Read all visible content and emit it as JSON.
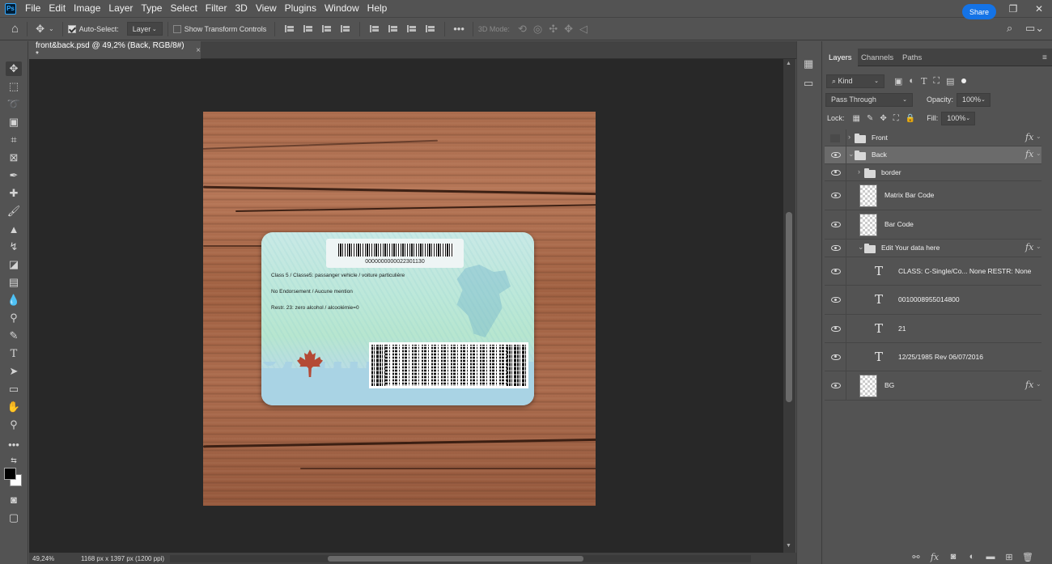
{
  "app": {
    "logo": "Ps"
  },
  "menu": [
    "File",
    "Edit",
    "Image",
    "Layer",
    "Type",
    "Select",
    "Filter",
    "3D",
    "View",
    "Plugins",
    "Window",
    "Help"
  ],
  "window_controls": {
    "minimize": "—",
    "restore": "❐",
    "close": "✕"
  },
  "options": {
    "auto_select_label": "Auto-Select:",
    "auto_select_checked": true,
    "auto_select_target": "Layer",
    "show_transform_label": "Show Transform Controls",
    "show_transform_checked": false,
    "mode_3d_label": "3D Mode:",
    "more": "•••",
    "share_label": "Share"
  },
  "document": {
    "tab_title": "front&back.psd @ 49,2% (Back, RGB/8#) *",
    "close": "×",
    "zoom": "49,24%",
    "doc_info": "1168 px x 1397 px (1200 ppi)"
  },
  "card": {
    "barcode_number": "0000000000022301130",
    "line1": "Class 5 / Classe5: passanger vehicle / voiture particulière",
    "line2": "No Endorsement / Aucune mention",
    "line3": "Restr. 23: zero alcohol / alcoolémie=0"
  },
  "panel": {
    "tabs": [
      "Layers",
      "Channels",
      "Paths"
    ],
    "active_tab": 0,
    "filter_label": "Kind",
    "blend_mode": "Pass Through",
    "opacity_label": "Opacity:",
    "opacity": "100%",
    "lock_label": "Lock:",
    "fill_label": "Fill:",
    "fill": "100%"
  },
  "layers": [
    {
      "name": "Front",
      "type": "group",
      "visible": false,
      "fx": true,
      "expanded": false,
      "indent": 0
    },
    {
      "name": "Back",
      "type": "group",
      "visible": true,
      "fx": true,
      "expanded": true,
      "indent": 0,
      "selected": true
    },
    {
      "name": "border",
      "type": "group",
      "visible": true,
      "fx": false,
      "expanded": false,
      "indent": 1
    },
    {
      "name": "Matrix Bar Code",
      "type": "pixel",
      "visible": true,
      "fx": false,
      "indent": 1
    },
    {
      "name": "Bar Code",
      "type": "pixel",
      "visible": true,
      "fx": false,
      "indent": 1
    },
    {
      "name": "Edit Your data here",
      "type": "group",
      "visible": true,
      "fx": true,
      "expanded": true,
      "indent": 1
    },
    {
      "name": "CLASS: C-Single/Co... None RESTR: None",
      "type": "text",
      "visible": true,
      "fx": false,
      "indent": 2
    },
    {
      "name": "0010008955014800",
      "type": "text",
      "visible": true,
      "fx": false,
      "indent": 2
    },
    {
      "name": "21",
      "type": "text",
      "visible": true,
      "fx": false,
      "indent": 2
    },
    {
      "name": "12/25/1985 Rev 06/07/2016",
      "type": "text",
      "visible": true,
      "fx": false,
      "indent": 2
    },
    {
      "name": "BG",
      "type": "pixel",
      "visible": true,
      "fx": true,
      "indent": 1
    }
  ],
  "colors": {
    "accent": "#1473e6",
    "ui_bg": "#535353",
    "canvas_bg": "#282828",
    "panel_tab_bg": "#424242"
  }
}
